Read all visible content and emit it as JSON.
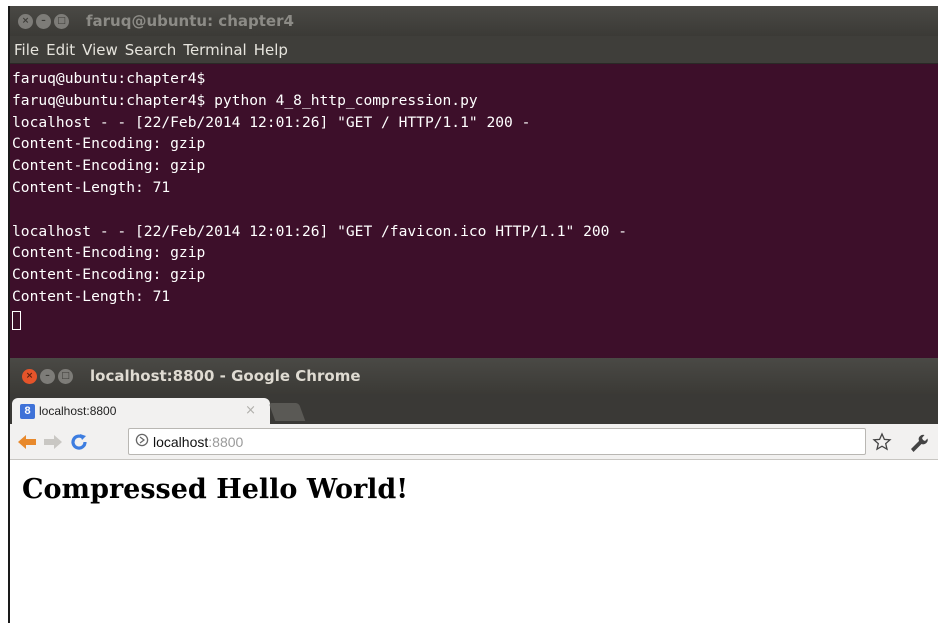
{
  "terminal": {
    "title": "faruq@ubuntu: chapter4",
    "menu": [
      "File",
      "Edit",
      "View",
      "Search",
      "Terminal",
      "Help"
    ],
    "lines": [
      "faruq@ubuntu:chapter4$",
      "faruq@ubuntu:chapter4$ python 4_8_http_compression.py",
      "localhost - - [22/Feb/2014 12:01:26] \"GET / HTTP/1.1\" 200 -",
      "Content-Encoding: gzip",
      "Content-Encoding: gzip",
      "Content-Length: 71",
      "",
      "localhost - - [22/Feb/2014 12:01:26] \"GET /favicon.ico HTTP/1.1\" 200 -",
      "Content-Encoding: gzip",
      "Content-Encoding: gzip",
      "Content-Length: 71"
    ]
  },
  "chrome": {
    "title": "localhost:8800 - Google Chrome",
    "tab_label": "localhost:8800",
    "favicon_letter": "8",
    "url_host": "localhost",
    "url_port": ":8800",
    "page_heading": "Compressed Hello World!"
  },
  "icons": {
    "terminal_buttons": [
      "close-icon",
      "minimize-icon",
      "maximize-icon"
    ],
    "chrome_buttons": [
      "close-icon",
      "minimize-icon",
      "maximize-icon"
    ],
    "toolbar": [
      "back-arrow-icon",
      "forward-arrow-icon",
      "reload-icon",
      "page-icon",
      "star-icon",
      "wrench-icon"
    ]
  },
  "colors": {
    "terminal_bg": "#3d0f2a",
    "titlebar": "#3b3a36",
    "close_red": "#e5542a",
    "back_arrow": "#e8892c",
    "reload": "#3d7de0"
  }
}
